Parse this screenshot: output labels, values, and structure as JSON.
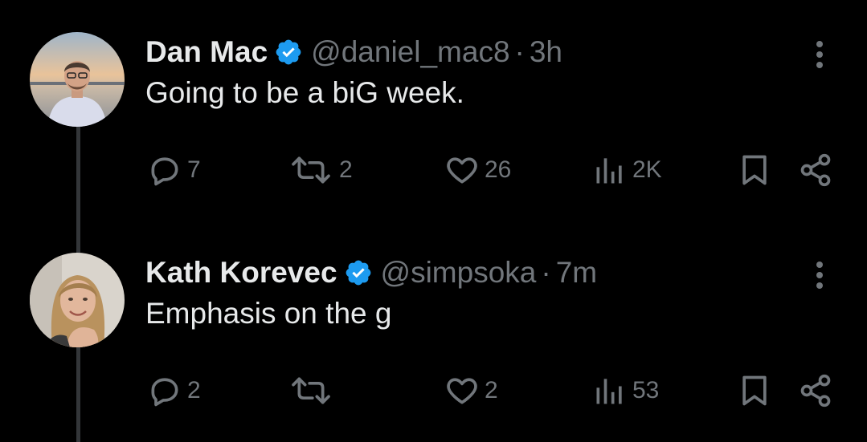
{
  "tweets": [
    {
      "name": "Dan Mac",
      "handle": "@daniel_mac8",
      "separator": "·",
      "time": "3h",
      "text": "Going to be a biG week.",
      "replies": "7",
      "reposts": "2",
      "likes": "26",
      "views": "2K",
      "verified": true
    },
    {
      "name": "Kath Korevec",
      "handle": "@simpsoka",
      "separator": "·",
      "time": "7m",
      "text": "Emphasis on the g",
      "replies": "2",
      "reposts": "",
      "likes": "2",
      "views": "53",
      "verified": true
    }
  ],
  "colors": {
    "background": "#000000",
    "primary_text": "#e7e9ea",
    "secondary_text": "#71767b",
    "verified_badge": "#1d9bf0",
    "thread_line": "#333639"
  },
  "icons": [
    "more-vertical-icon",
    "verified-badge-icon",
    "reply-icon",
    "repost-icon",
    "like-icon",
    "views-icon",
    "bookmark-icon",
    "share-icon"
  ]
}
